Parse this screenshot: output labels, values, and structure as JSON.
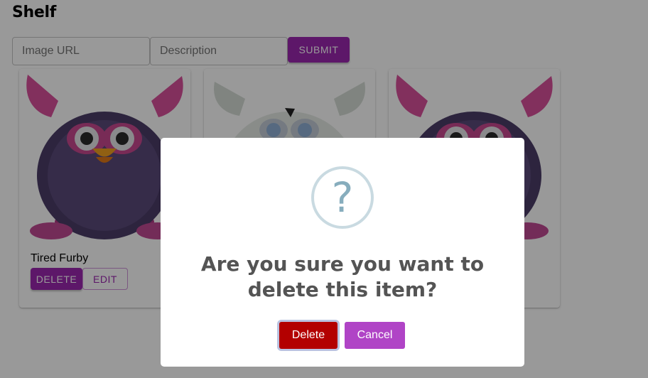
{
  "header": {
    "title": "Shelf"
  },
  "form": {
    "url_placeholder": "Image URL",
    "description_placeholder": "Description",
    "submit_label": "SUBMIT"
  },
  "items": [
    {
      "caption": "Tired Furby",
      "delete_label": "DELETE",
      "edit_label": "EDIT",
      "image": "purple-furby"
    },
    {
      "caption": "",
      "image": "white-furby"
    },
    {
      "caption": "",
      "image": "purple-furby"
    }
  ],
  "dialog": {
    "icon": "question-icon",
    "icon_glyph": "?",
    "title": "Are you sure you want to delete this item?",
    "confirm_label": "Delete",
    "cancel_label": "Cancel"
  },
  "colors": {
    "primary": "#9c27b0",
    "danger": "#b30000",
    "cancel": "#b044c6"
  }
}
